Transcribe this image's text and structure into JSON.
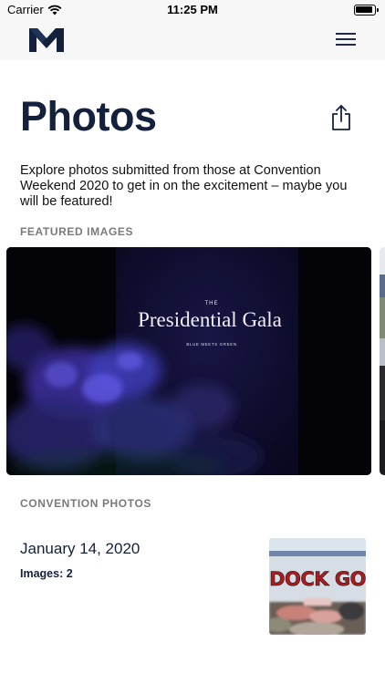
{
  "status_bar": {
    "carrier": "Carrier",
    "time": "11:25 PM"
  },
  "nav": {
    "logo_icon": "m-logo-icon",
    "menu_icon": "hamburger-menu-icon"
  },
  "header": {
    "title": "Photos",
    "share_icon": "share-icon"
  },
  "intro_text": "Explore photos submitted from those at Convention Weekend 2020 to get in on the excitement – maybe you will be featured!",
  "featured": {
    "label": "FEATURED IMAGES",
    "photo": {
      "sign_small": "THE",
      "sign_title": "Presidential Gala",
      "sign_tagline": "BLUE MEETS GREEN"
    }
  },
  "convention": {
    "label": "CONVENTION PHOTOS",
    "albums": [
      {
        "date": "January 14, 2020",
        "count_text": "Images: 2",
        "thumb_text": "DOCK GO"
      }
    ]
  },
  "colors": {
    "brand_navy": "#14213d",
    "section_gray": "#7a7a7a",
    "bar_bg": "#f7f7f8"
  }
}
